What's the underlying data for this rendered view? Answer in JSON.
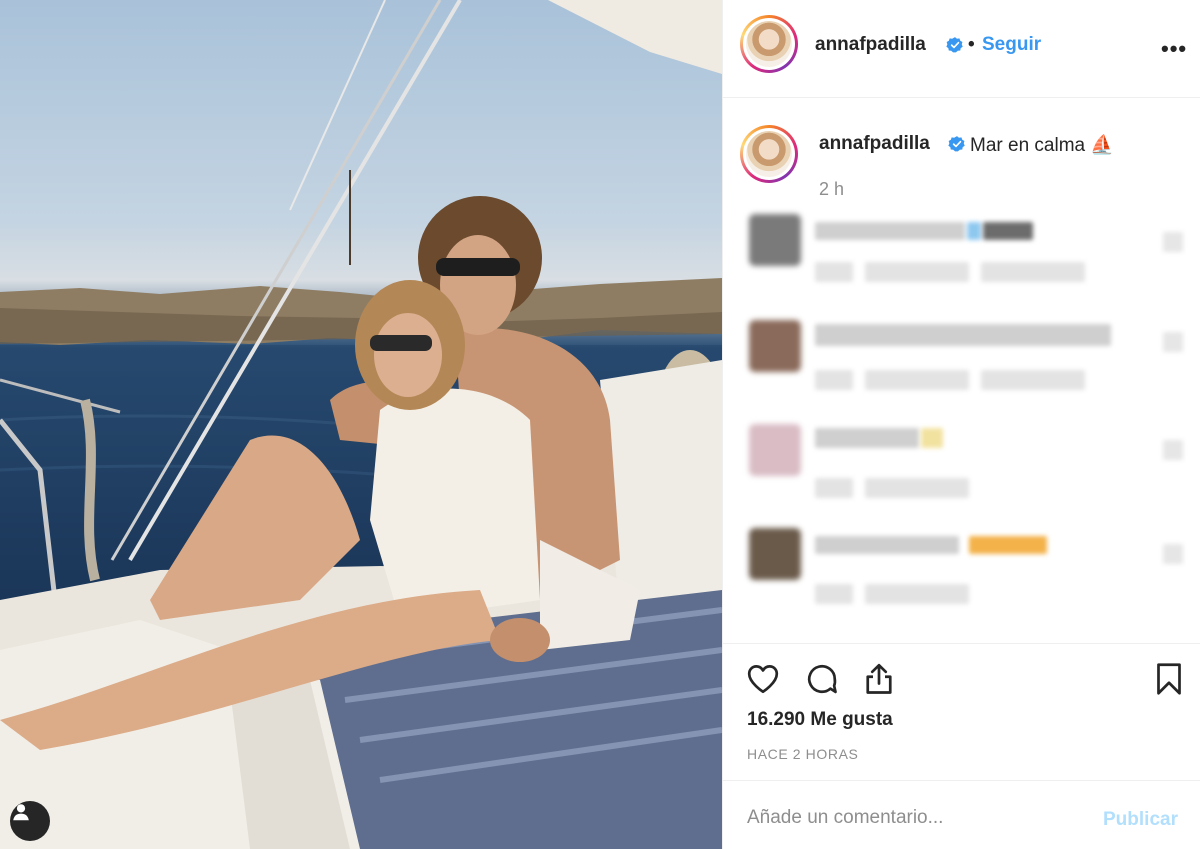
{
  "post": {
    "username": "annafpadilla",
    "follow_label": "Seguir",
    "separator": "•",
    "more_label": "•••",
    "caption": "Mar en calma ⛵",
    "time": "2 h",
    "likes": "16.290 Me gusta",
    "ago": "HACE 2 HORAS"
  },
  "comment_form": {
    "placeholder": "Añade un comentario...",
    "publish_label": "Publicar"
  },
  "colors": {
    "link_blue": "#3897f0",
    "publish_disabled": "#b2dffc",
    "muted_text": "#8e8e8e"
  },
  "icons": [
    "verified-badge-icon",
    "more-options-icon",
    "heart-icon",
    "comment-icon",
    "share-icon",
    "bookmark-icon",
    "user-tag-icon"
  ]
}
